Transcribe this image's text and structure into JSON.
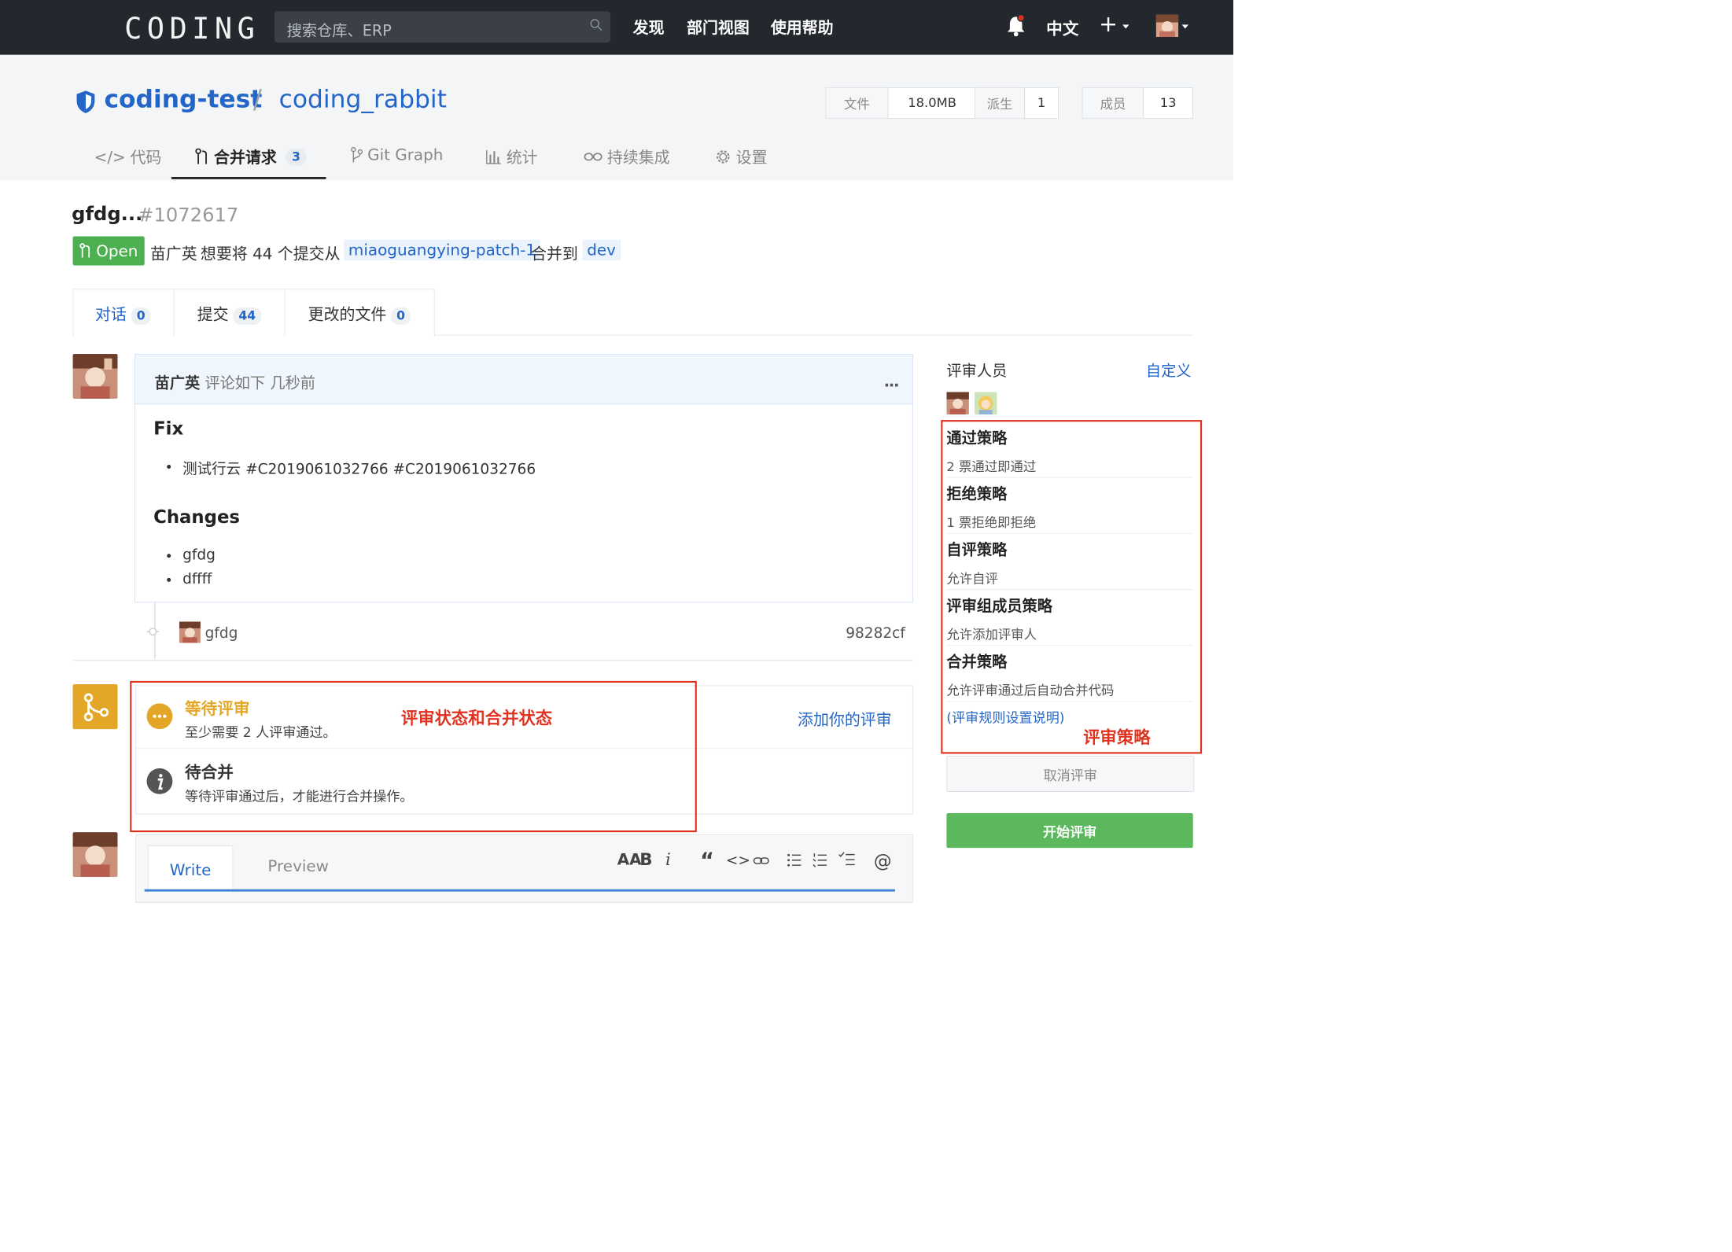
{
  "header": {
    "logo": "CODING",
    "search_placeholder": "搜索仓库、ERP",
    "nav": [
      "发现",
      "部门视图",
      "使用帮助"
    ],
    "lang": "中文",
    "plus": "+"
  },
  "repo": {
    "owner": "coding-test",
    "separator": "/",
    "name": "coding_rabbit",
    "stats": [
      {
        "label": "文件",
        "value": "18.0MB"
      },
      {
        "label": "派生",
        "value": "1"
      },
      {
        "label": "成员",
        "value": "13"
      }
    ],
    "tabs": [
      {
        "label": "代码",
        "prefix": "</>"
      },
      {
        "label": "合并请求",
        "count": "3"
      },
      {
        "label": "Git Graph"
      },
      {
        "label": "统计"
      },
      {
        "label": "持续集成"
      },
      {
        "label": "设置"
      }
    ]
  },
  "pr": {
    "title": "gfdg...",
    "number": "#1072617",
    "status": "Open",
    "author": "苗广英",
    "desc_mid": "想要将 44 个提交从",
    "source_branch": "miaoguangying-patch-1",
    "desc_to": "合并到",
    "target_branch": "dev"
  },
  "subtabs": [
    {
      "label": "对话",
      "count": "0"
    },
    {
      "label": "提交",
      "count": "44"
    },
    {
      "label": "更改的文件",
      "count": "0"
    }
  ],
  "comment": {
    "author": "苗广英",
    "meta": "评论如下 几秒前",
    "more": "...",
    "heading1": "Fix",
    "fix_items": [
      "测试行云 #C2019061032766 #C2019061032766"
    ],
    "heading2": "Changes",
    "change_items": [
      "gfdg",
      "dffff"
    ]
  },
  "commit": {
    "message": "gfdg",
    "hash": "98282cf"
  },
  "review_status": {
    "wait_title": "等待评审",
    "wait_desc": "至少需要 2 人评审通过。",
    "merge_title": "待合并",
    "merge_desc": "等待评审通过后，才能进行合并操作。",
    "add_review": "添加你的评审",
    "annotation": "评审状态和合并状态"
  },
  "editor": {
    "tab_write": "Write",
    "tab_preview": "Preview",
    "toolbar": [
      "AA",
      "B",
      "i",
      "“",
      "<>",
      "link",
      "ul",
      "ol",
      "task",
      "@"
    ]
  },
  "sidebar": {
    "reviewers_title": "评审人员",
    "customize": "自定义",
    "policies": [
      {
        "title": "通过策略",
        "desc": "2 票通过即通过"
      },
      {
        "title": "拒绝策略",
        "desc": "1 票拒绝即拒绝"
      },
      {
        "title": "自评策略",
        "desc": "允许自评"
      },
      {
        "title": "评审组成员策略",
        "desc": "允许添加评审人"
      },
      {
        "title": "合并策略",
        "desc": "允许评审通过后自动合并代码"
      }
    ],
    "rules_link": "(评审规则设置说明)",
    "annotation": "评审策略",
    "cancel_button": "取消评审",
    "start_button": "开始评审"
  },
  "colors": {
    "accent_blue": "#2466c8",
    "open_green": "#4caf50",
    "warning_orange": "#e3a627",
    "annotation_red": "#e0301e",
    "topbar": "#23272e"
  }
}
